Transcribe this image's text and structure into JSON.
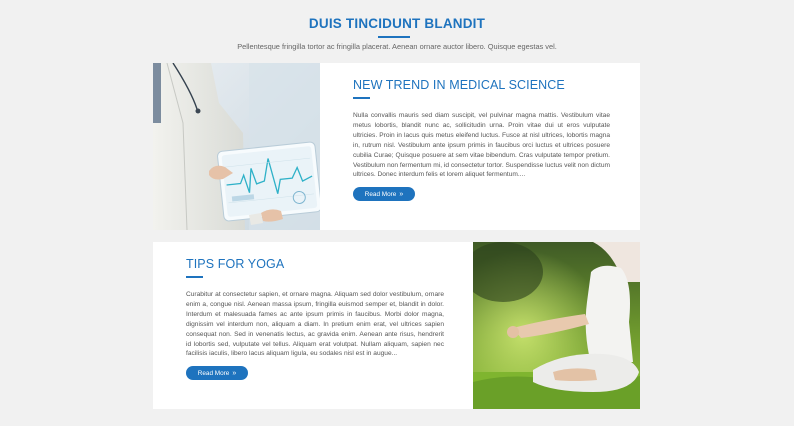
{
  "section": {
    "title": "DUIS TINCIDUNT BLANDIT",
    "subtitle": "Pellentesque fringilla tortor ac fringilla placerat. Aenean ornare auctor libero. Quisque egestas vel."
  },
  "cards": [
    {
      "title": "NEW TREND IN MEDICAL SCIENCE",
      "body": "Nulla convallis mauris sed diam suscipit, vel pulvinar magna mattis. Vestibulum vitae metus lobortis, blandit nunc ac, sollicitudin urna. Proin vitae dui ut eros vulputate ultricies. Proin in lacus quis metus eleifend luctus. Fusce at nisl ultrices, lobortis magna in, rutrum nisl. Vestibulum ante ipsum primis in faucibus orci luctus et ultrices posuere cubilia Curae; Quisque posuere at sem vitae bibendum. Cras vulputate tempor pretium. Vestibulum non fermentum mi, id consectetur tortor. Suspendisse luctus velit non dictum ultrices. Donec interdum felis et lorem aliquet fermentum....",
      "button": "Read More",
      "button_icon": "»"
    },
    {
      "title": "TIPS FOR YOGA",
      "body": "Curabitur at consectetur sapien, et ornare magna. Aliquam sed dolor vestibulum, ornare enim a, congue nisl. Aenean massa ipsum, fringilla euismod semper et, blandit in dolor. Interdum et malesuada fames ac ante ipsum primis in faucibus. Morbi dolor magna, dignissim vel interdum non, aliquam a diam. In pretium enim erat, vel ultrices sapien consequat non. Sed in venenatis lectus, ac gravida enim. Aenean ante risus, hendrerit id lobortis sed, vulputate vel tellus. Aliquam erat volutpat. Nullam aliquam, sapien nec facilisis iaculis, libero lacus aliquam ligula, eu sodales nisl est in augue...",
      "button": "Read More",
      "button_icon": "»"
    }
  ],
  "colors": {
    "accent": "#1e73be",
    "background": "#f1f1f1",
    "card": "#ffffff"
  }
}
